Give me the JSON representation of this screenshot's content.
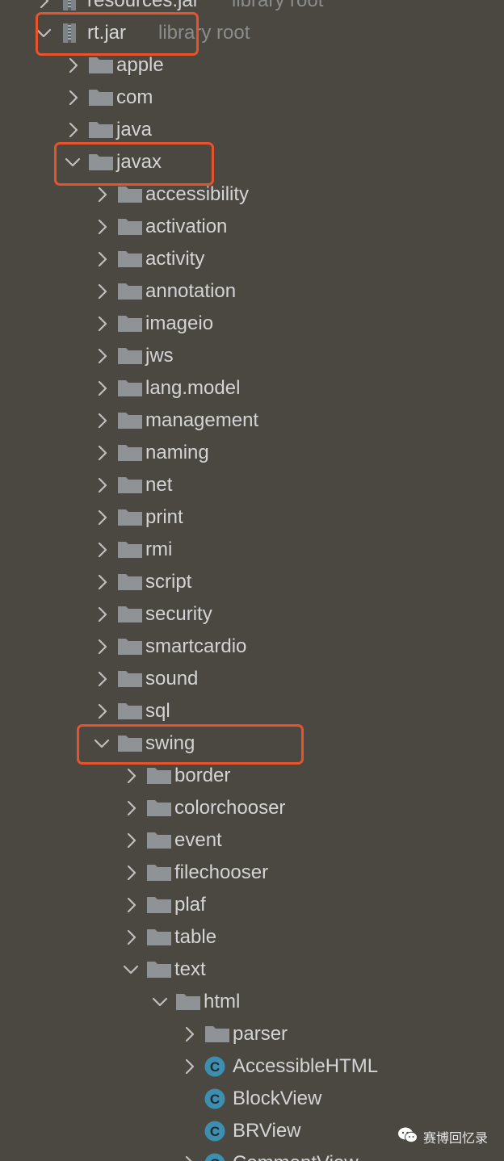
{
  "tree": {
    "rows": [
      {
        "label": "resources.jar",
        "suffix": "library root",
        "depth": 0,
        "kind": "jar",
        "expanded": false
      },
      {
        "label": "rt.jar",
        "suffix": "library root",
        "depth": 0,
        "kind": "jar",
        "expanded": true
      },
      {
        "label": "apple",
        "depth": 1,
        "kind": "folder",
        "expanded": false
      },
      {
        "label": "com",
        "depth": 1,
        "kind": "folder",
        "expanded": false
      },
      {
        "label": "java",
        "depth": 1,
        "kind": "folder",
        "expanded": false
      },
      {
        "label": "javax",
        "depth": 1,
        "kind": "folder",
        "expanded": true
      },
      {
        "label": "accessibility",
        "depth": 2,
        "kind": "folder",
        "expanded": false
      },
      {
        "label": "activation",
        "depth": 2,
        "kind": "folder",
        "expanded": false
      },
      {
        "label": "activity",
        "depth": 2,
        "kind": "folder",
        "expanded": false
      },
      {
        "label": "annotation",
        "depth": 2,
        "kind": "folder",
        "expanded": false
      },
      {
        "label": "imageio",
        "depth": 2,
        "kind": "folder",
        "expanded": false
      },
      {
        "label": "jws",
        "depth": 2,
        "kind": "folder",
        "expanded": false
      },
      {
        "label": "lang.model",
        "depth": 2,
        "kind": "folder",
        "expanded": false
      },
      {
        "label": "management",
        "depth": 2,
        "kind": "folder",
        "expanded": false
      },
      {
        "label": "naming",
        "depth": 2,
        "kind": "folder",
        "expanded": false
      },
      {
        "label": "net",
        "depth": 2,
        "kind": "folder",
        "expanded": false
      },
      {
        "label": "print",
        "depth": 2,
        "kind": "folder",
        "expanded": false
      },
      {
        "label": "rmi",
        "depth": 2,
        "kind": "folder",
        "expanded": false
      },
      {
        "label": "script",
        "depth": 2,
        "kind": "folder",
        "expanded": false
      },
      {
        "label": "security",
        "depth": 2,
        "kind": "folder",
        "expanded": false
      },
      {
        "label": "smartcardio",
        "depth": 2,
        "kind": "folder",
        "expanded": false
      },
      {
        "label": "sound",
        "depth": 2,
        "kind": "folder",
        "expanded": false
      },
      {
        "label": "sql",
        "depth": 2,
        "kind": "folder",
        "expanded": false
      },
      {
        "label": "swing",
        "depth": 2,
        "kind": "folder",
        "expanded": true
      },
      {
        "label": "border",
        "depth": 3,
        "kind": "folder",
        "expanded": false
      },
      {
        "label": "colorchooser",
        "depth": 3,
        "kind": "folder",
        "expanded": false
      },
      {
        "label": "event",
        "depth": 3,
        "kind": "folder",
        "expanded": false
      },
      {
        "label": "filechooser",
        "depth": 3,
        "kind": "folder",
        "expanded": false
      },
      {
        "label": "plaf",
        "depth": 3,
        "kind": "folder",
        "expanded": false
      },
      {
        "label": "table",
        "depth": 3,
        "kind": "folder",
        "expanded": false
      },
      {
        "label": "text",
        "depth": 3,
        "kind": "folder",
        "expanded": true
      },
      {
        "label": "html",
        "depth": 4,
        "kind": "folder",
        "expanded": true
      },
      {
        "label": "parser",
        "depth": 5,
        "kind": "folder",
        "expanded": false
      },
      {
        "label": "AccessibleHTML",
        "depth": 5,
        "kind": "class",
        "expanded": false
      },
      {
        "label": "BlockView",
        "depth": 5,
        "kind": "class",
        "leaf": true
      },
      {
        "label": "BRView",
        "depth": 5,
        "kind": "class",
        "leaf": true
      },
      {
        "label": "CommentView",
        "depth": 5,
        "kind": "class",
        "expanded": false
      }
    ]
  },
  "highlights": [
    "rt.jar",
    "javax",
    "swing"
  ],
  "watermark": {
    "text": "赛博回忆录",
    "icon": "wechat-icon"
  },
  "colors": {
    "background": "#4b4842",
    "text": "#d4d4d4",
    "muted_text": "#8c8c8c",
    "folder": "#8f9396",
    "class_badge": "#3d8fb0",
    "highlight": "#e8532b"
  }
}
